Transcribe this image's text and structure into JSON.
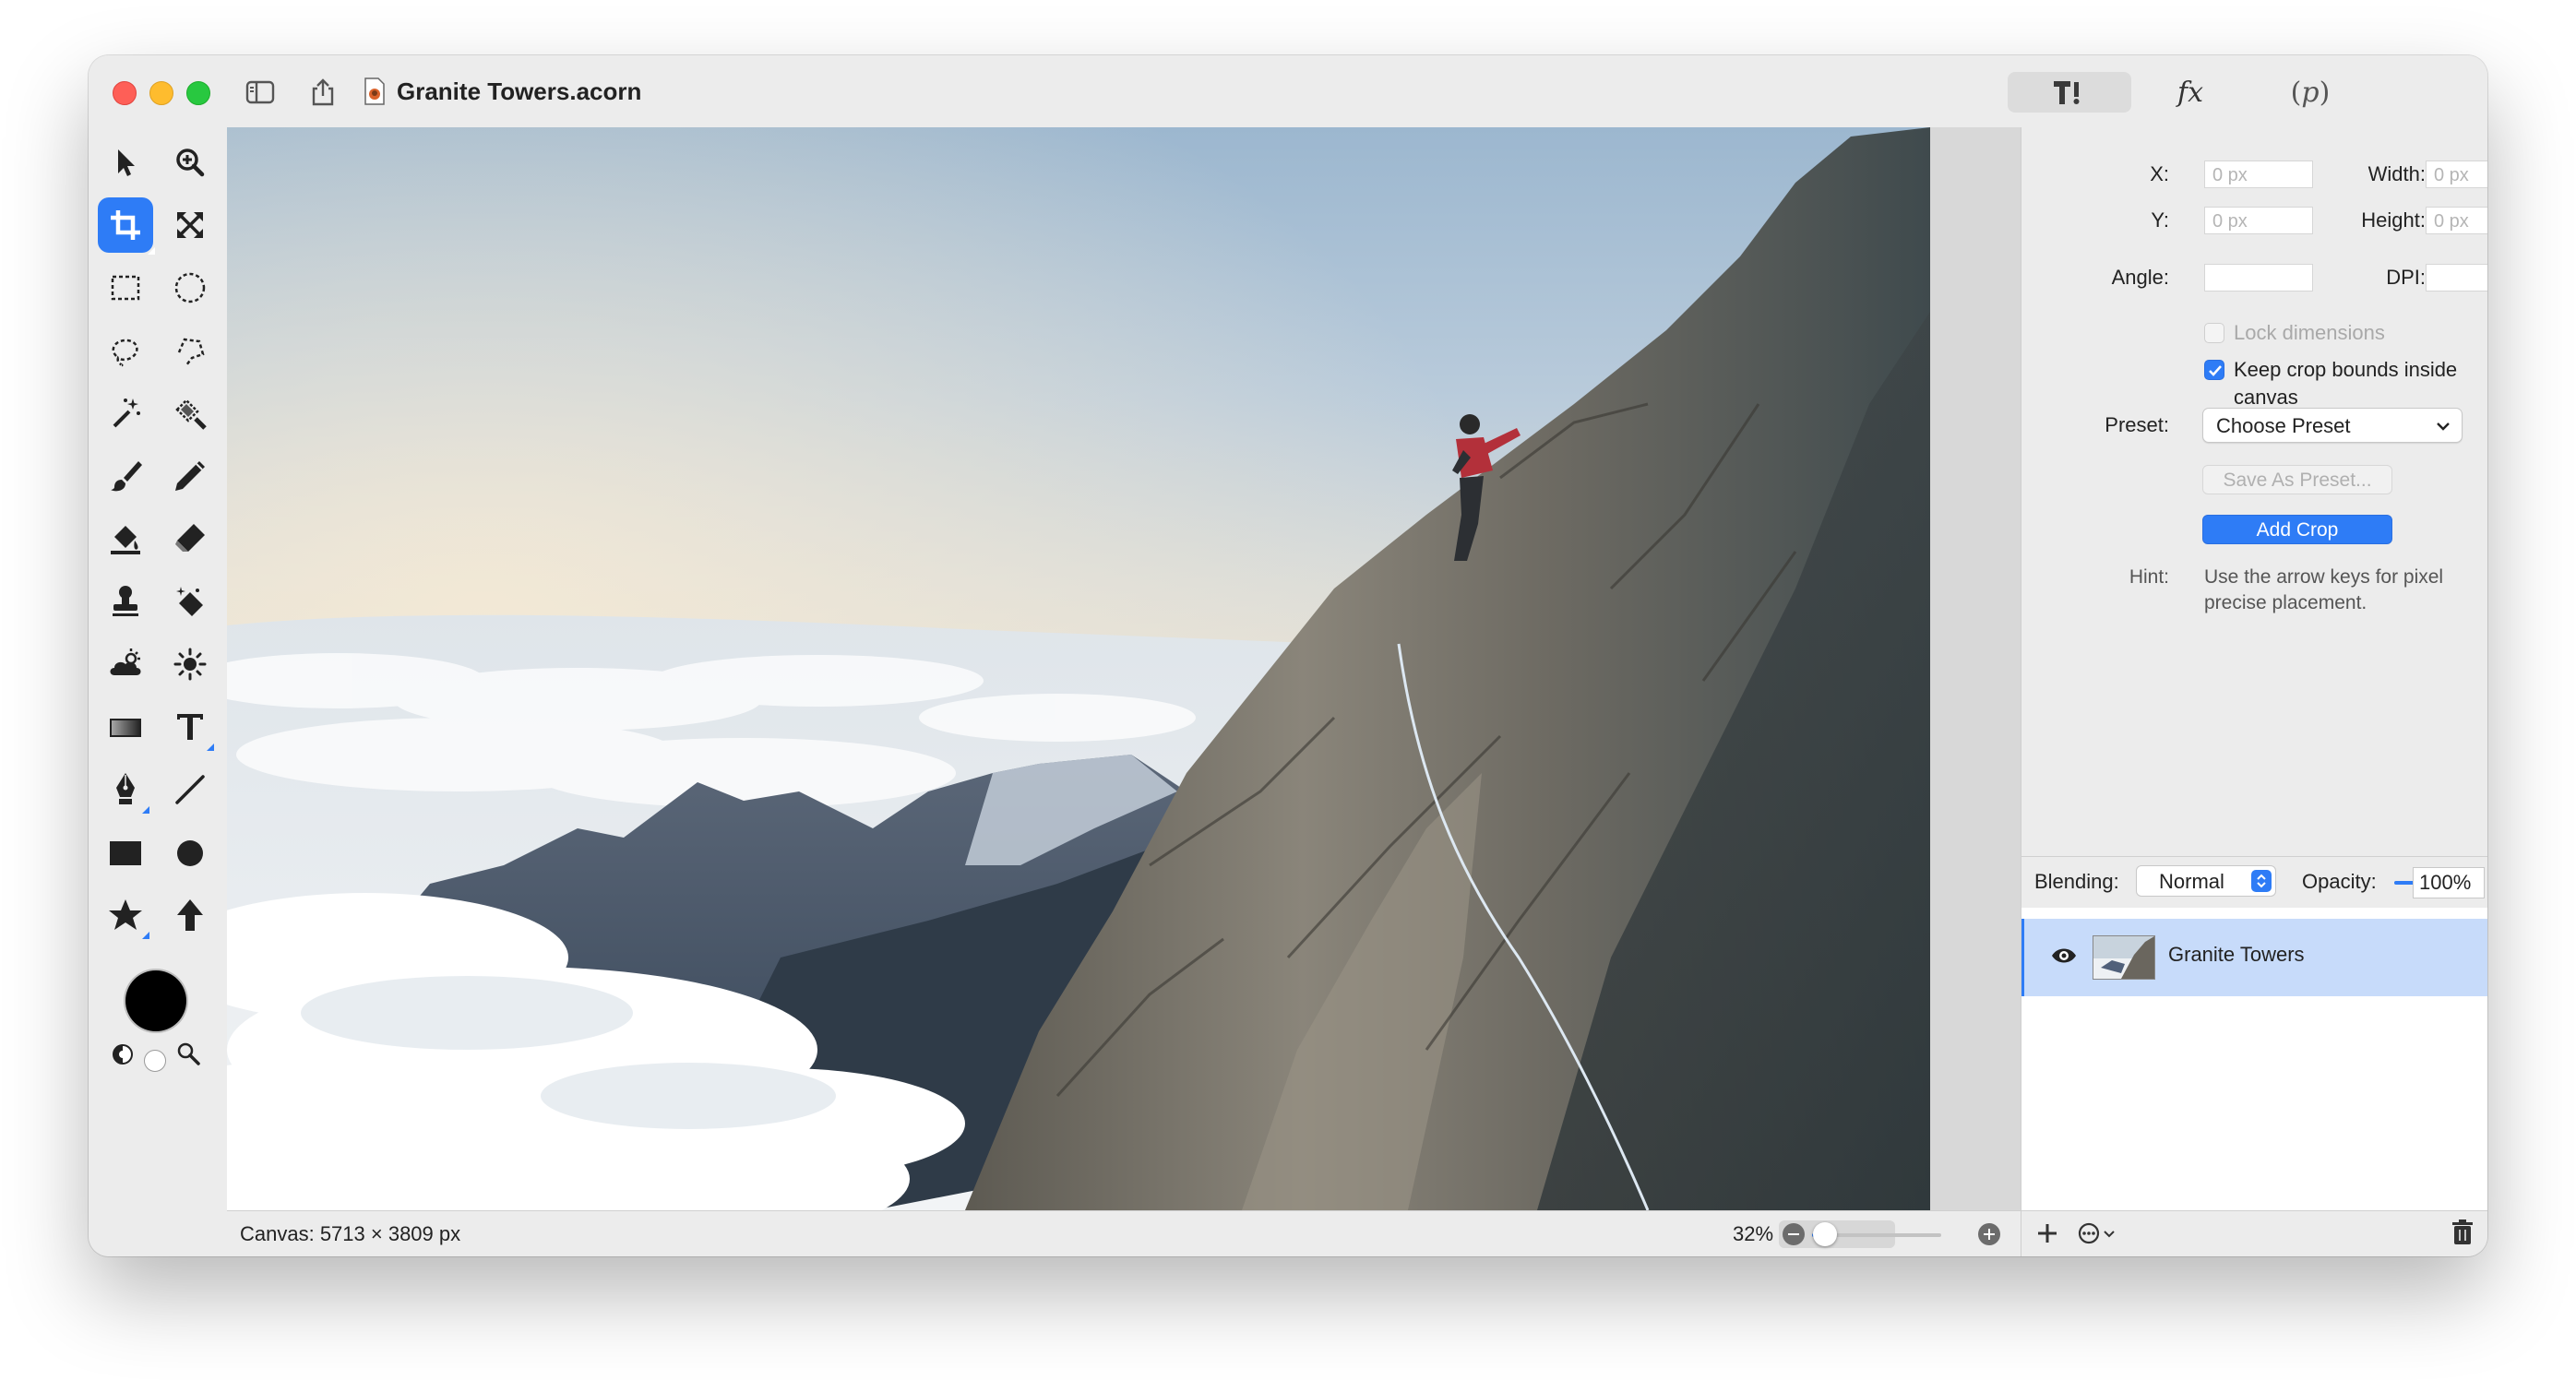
{
  "window": {
    "title": "Granite Towers.acorn"
  },
  "titlebar": {
    "icons": [
      "sidebar-toggle-icon",
      "share-icon",
      "document-icon"
    ],
    "segments": [
      {
        "name": "tools-segment",
        "label": "T!",
        "active": true
      },
      {
        "name": "fx-segment",
        "label": "fx",
        "active": false
      },
      {
        "name": "properties-segment",
        "label": "(p)",
        "active": false
      }
    ]
  },
  "toolbar": {
    "tools": [
      "select-arrow-icon",
      "zoom-icon",
      "crop-icon",
      "expand-icon",
      "rect-select-icon",
      "ellipse-select-icon",
      "lasso-icon",
      "polygon-lasso-icon",
      "magic-wand-icon",
      "magic-brush-icon",
      "paintbrush-icon",
      "pencil-icon",
      "paint-bucket-icon",
      "eraser-icon",
      "clone-stamp-icon",
      "magic-eraser-icon",
      "burn-icon",
      "dodge-icon",
      "gradient-icon",
      "text-icon",
      "pen-icon",
      "line-icon",
      "rectangle-icon",
      "circle-icon",
      "star-icon",
      "arrow-icon"
    ],
    "active_tool": "crop-icon",
    "foreground_color": "#000000",
    "background_color": "#ffffff"
  },
  "status": {
    "canvas_size": "Canvas: 5713 × 3809 px",
    "zoom": "32%",
    "zoom_level": 0.1
  },
  "inspector": {
    "x_label": "X:",
    "x_value": "0 px",
    "y_label": "Y:",
    "y_value": "0 px",
    "width_label": "Width:",
    "width_value": "0 px",
    "height_label": "Height:",
    "height_value": "0 px",
    "angle_label": "Angle:",
    "angle_value": "",
    "dpi_label": "DPI:",
    "dpi_value": "",
    "lock_dimensions": "Lock dimensions",
    "lock_dimensions_checked": false,
    "keep_bounds": "Keep crop bounds inside canvas",
    "keep_bounds_checked": true,
    "preset_label": "Preset:",
    "preset_value": "Choose Preset",
    "save_preset": "Save As Preset...",
    "add_crop": "Add Crop",
    "hint_label": "Hint:",
    "hint_line1": "Use the arrow keys for pixel",
    "hint_line2": "precise placement."
  },
  "layers": {
    "blending_label": "Blending:",
    "blending_value": "Normal",
    "opacity_label": "Opacity:",
    "opacity_value": "100%",
    "opacity_level": 1.0,
    "items": [
      {
        "name": "Granite Towers",
        "visible": true,
        "selected": true
      }
    ]
  },
  "colors": {
    "accent": "#2e7cf6",
    "selection": "#c7dbfa"
  }
}
